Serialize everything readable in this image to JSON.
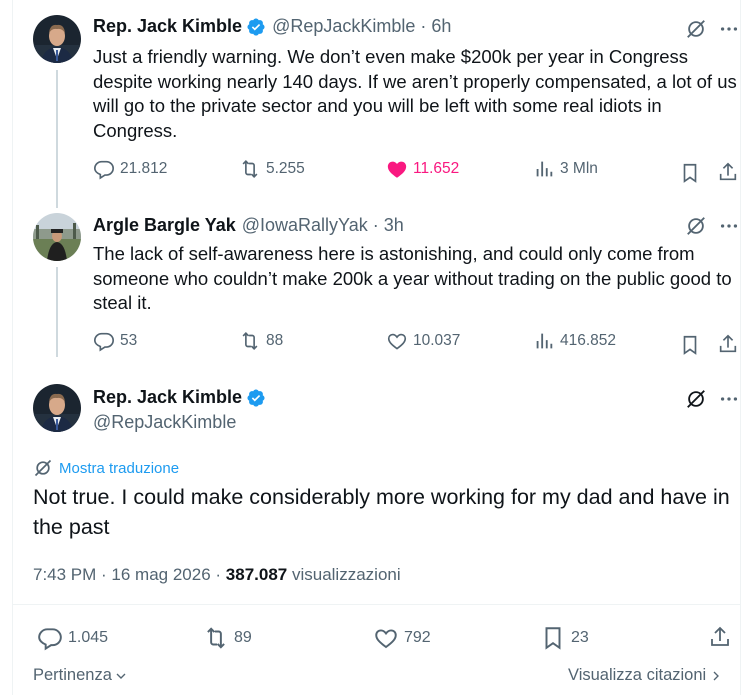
{
  "verified_color": "#1d9bf0",
  "like_color": "#f91880",
  "tweets": [
    {
      "name": "Rep. Jack Kimble",
      "handle": "@RepJackKimble",
      "time": "· 6h",
      "text": "Just a friendly warning. We don’t even make $200k per year in Congress despite working nearly 140 days.  If we aren’t properly compensated, a lot of us will go to the private sector and you will be left with some real idiots in Congress.",
      "replies": "21.812",
      "reposts": "5.255",
      "likes": "11.652",
      "views": "3 Mln",
      "liked": true
    },
    {
      "name": "Argle Bargle Yak",
      "handle": "@IowaRallyYak",
      "time": "· 3h",
      "text": "The lack of self-awareness here is astonishing, and could only come from someone who couldn’t make 200k a year without trading on the public good to steal it.",
      "replies": "53",
      "reposts": "88",
      "likes": "10.037",
      "views": "416.852",
      "liked": false
    }
  ],
  "main": {
    "name": "Rep. Jack Kimble",
    "handle": "@RepJackKimble",
    "translate": "Mostra traduzione",
    "text": "Not true.  I could make considerably more working for my dad and have in the past",
    "datetime": "7:43 PM · 16 mag 2026 ·",
    "views_count": "387.087",
    "views_label": "visualizzazioni",
    "replies": "1.045",
    "reposts": "89",
    "likes": "792",
    "bookmarks": "23"
  },
  "footer": {
    "sort": "Pertinenza",
    "quotes": "Visualizza citazioni"
  }
}
